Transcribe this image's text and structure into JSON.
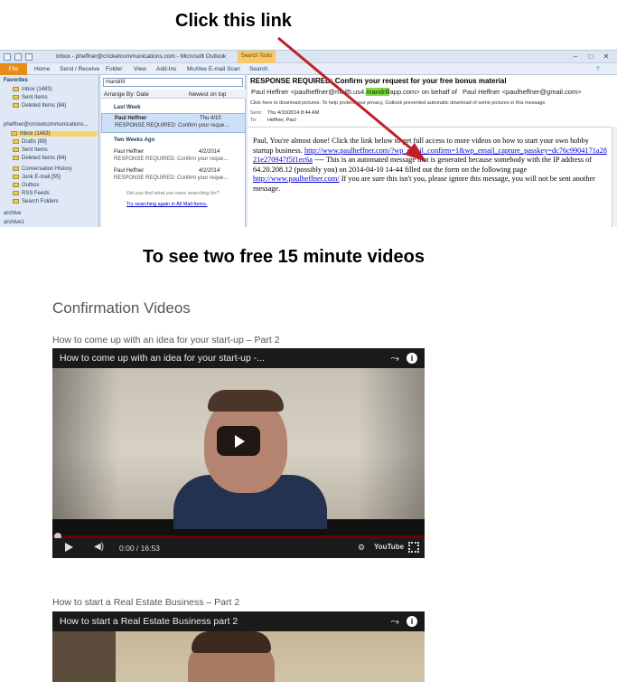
{
  "annotation_top": "Click this link",
  "annotation_mid": "To see two  free 15 minute videos",
  "outlook": {
    "window_title": "Inbox - pheffner@cricketcommunications.com - Microsoft Outlook",
    "search_tools": "Search Tools",
    "tabs": [
      "File",
      "Home",
      "Send / Receive",
      "Folder",
      "View",
      "Add-Ins",
      "McAfee E-mail Scan",
      "Search"
    ],
    "favorites_label": "Favorites",
    "favorites": [
      "Inbox (1483)",
      "Sent Items",
      "Deleted Items (84)"
    ],
    "account": "pheffner@cricketcommunications...",
    "folders": [
      "Inbox (1483)",
      "Drafts [89]",
      "Sent Items",
      "Deleted Items (84)",
      "Conversation History",
      "Junk E-mail [55]",
      "Outbox",
      "RSS Feeds",
      "Search Folders"
    ],
    "archives": [
      "archive",
      "archive1"
    ],
    "search_value": "mandrill",
    "arrange_by": "Arrange By: Date",
    "sort_order": "Newest on top",
    "group_last_week": "Last Week",
    "group_two_weeks": "Two Weeks Ago",
    "messages": [
      {
        "from": "Paul Heffner",
        "date": "Thu 4/10",
        "subject": "RESPONSE REQUIRED: Confirm your reque..."
      },
      {
        "from": "Paul Heffner",
        "date": "4/2/2014",
        "subject": "RESPONSE REQUIRED: Confirm your reque..."
      },
      {
        "from": "Paul Heffner",
        "date": "4/2/2014",
        "subject": "RESPONSE REQUIRED: Confirm your reque..."
      }
    ],
    "not_found": "Did you find what you were searching for?",
    "search_all": "Try searching again in All Mail Items.",
    "reading": {
      "subject": "RESPONSE REQUIRED: Confirm your request for your free bonus material",
      "from_prefix": "Paul Heffner <paulheffner@mail5.us4.",
      "from_highlight": "mandrill",
      "from_suffix": "app.com> on behalf of",
      "from_behalf": "Paul Heffner <paulheffner@gmail.com>",
      "info_bar": "Click here to download pictures. To help protect your privacy, Outlook prevented automatic download of some pictures in this message.",
      "sent_label": "Sent:",
      "sent_value": "Thu 4/10/2014 8:44 AM",
      "to_label": "To:",
      "to_value": "Heffner, Paul",
      "body_1": "Paul, You're almost done! Click the link below to get full access to more videos on how to start your own hobby startup business.",
      "link_1": "http://www.paulheffner.com/?wp_email_confirm=1&wp_email_capture_passkey=dc76c9904171a2821e270947f5f1ec6a",
      "body_2": " ---- This is an automated message that is generated because somebody with the IP address of 64.20.208.12 (possibly you) on 2014-04-10 14-44 filled out the form on the following page ",
      "link_2": "http://www.paulheffner.com/",
      "body_3": " If you are sure this isn't you, please ignore this message, you will not be sent another message."
    }
  },
  "section_title": "Confirmation Videos",
  "videos": [
    {
      "caption": "How to come up with an idea for your start-up – Part 2",
      "player_title": "How to come up with an idea for your start-up -...",
      "time": "0:00 / 16:53",
      "brand": "YouTube"
    },
    {
      "caption": "How to start a Real Estate Business – Part 2",
      "player_title": "How to start a Real Estate Business part 2"
    }
  ],
  "colors": {
    "arrow": "#c0202a",
    "file_tab": "#e98b1a",
    "highlight": "#7ddc3a",
    "player_bg": "#111111"
  }
}
